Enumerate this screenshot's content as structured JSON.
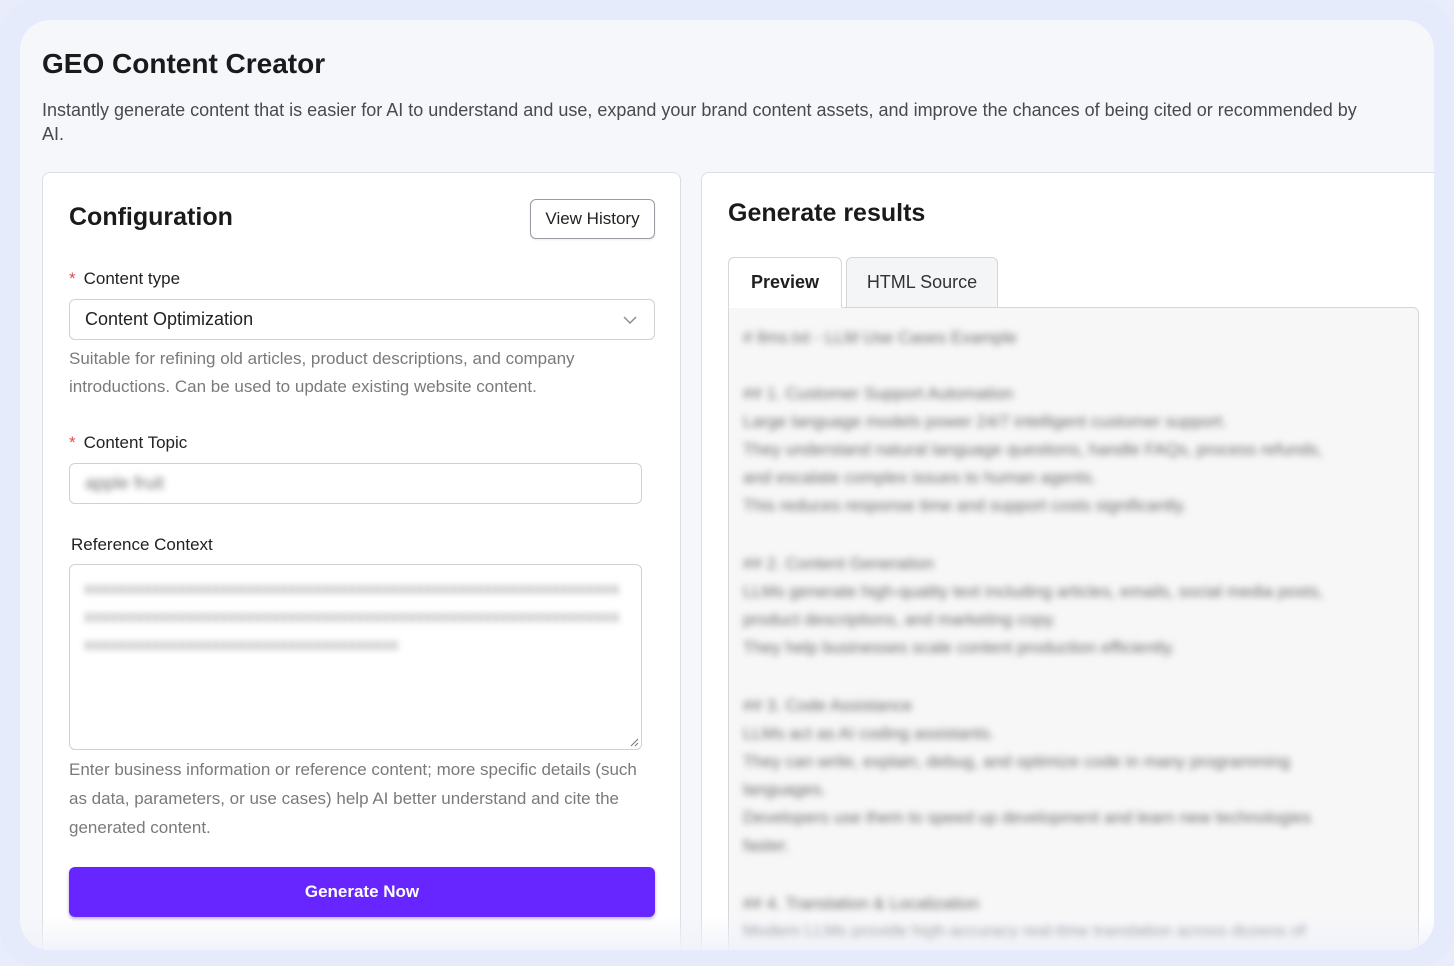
{
  "app": {
    "title": "GEO Content Creator",
    "description": "Instantly generate content that is easier for AI to understand and use, expand your brand content assets, and improve the chances of being cited or recommended by AI."
  },
  "config": {
    "title": "Configuration",
    "history_button": "View History",
    "content_type": {
      "label": "Content type",
      "required_mark": "*",
      "selected": "Content Optimization",
      "hint": "Suitable for refining old articles, product descriptions, and company introductions. Can be used to update existing website content."
    },
    "content_topic": {
      "label": "Content Topic",
      "required_mark": "*",
      "value": "apple fruit"
    },
    "reference_context": {
      "label": "Reference Context",
      "value": "xxxxxxxxxxxxxxxxxxxxxxxxxxxxxxxxxxxxxxxxxxxxxxxxxxxxxxxxxxxxxxxxxxxxxxxxxxxxxxxxxxxxxxxxxxxxxxxxxxxxxxxxxxxxxxxxxxxxxxxxxxxxxxxxxxxxxxxxxxxxxxxxxxxxxxxxxxxxxxxxxxx",
      "hint": "Enter business information or reference content; more specific details (such as data, parameters, or use cases) help AI better understand and cite the generated content."
    },
    "generate_button": "Generate Now"
  },
  "results": {
    "title": "Generate results",
    "tabs": [
      {
        "label": "Preview",
        "active": true
      },
      {
        "label": "HTML Source",
        "active": false
      }
    ],
    "preview_lines": [
      "# llms.txt - LLM Use Cases Example",
      "",
      "## 1. Customer Support Automation",
      "Large language models power 24/7 intelligent customer support.",
      "They understand natural language questions, handle FAQs, process refunds,",
      "and escalate complex issues to human agents.",
      "This reduces response time and support costs significantly.",
      "",
      "## 2. Content Generation",
      "LLMs generate high-quality text including articles, emails, social media posts,",
      "product descriptions, and marketing copy.",
      "They help businesses scale content production efficiently.",
      "",
      "## 3. Code Assistance",
      "LLMs act as AI coding assistants.",
      "They can write, explain, debug, and optimize code in many programming",
      "languages.",
      "Developers use them to speed up development and learn new technologies",
      "faster.",
      "",
      "## 4. Translation & Localization",
      "Modern LLMs provide high-accuracy real-time translation across dozens of"
    ]
  },
  "colors": {
    "accent": "#6726ff",
    "required": "#e34b4b",
    "frame": "#e6ebfb"
  }
}
